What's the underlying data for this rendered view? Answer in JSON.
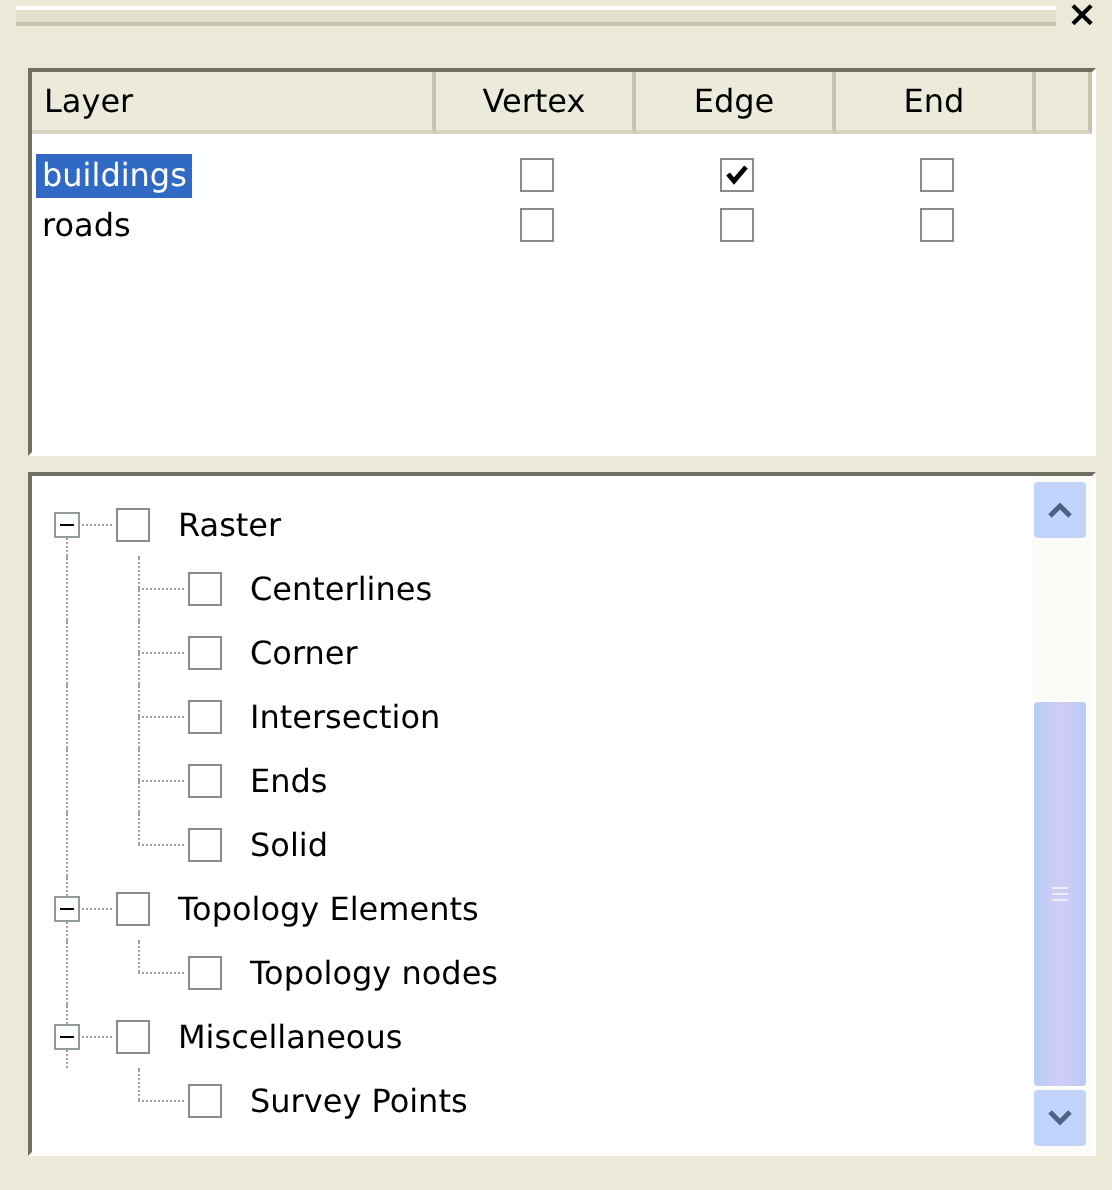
{
  "window": {
    "close": "×"
  },
  "layers_table": {
    "columns": [
      "Layer",
      "Vertex",
      "Edge",
      "End"
    ],
    "rows": [
      {
        "layer": "buildings",
        "selected": true,
        "vertex": false,
        "edge": true,
        "end": false
      },
      {
        "layer": "roads",
        "selected": false,
        "vertex": false,
        "edge": false,
        "end": false
      }
    ]
  },
  "snap_tree": [
    {
      "label": "Raster",
      "checked": false,
      "expanded": true,
      "children": [
        {
          "label": "Centerlines",
          "checked": false
        },
        {
          "label": "Corner",
          "checked": false
        },
        {
          "label": "Intersection",
          "checked": false
        },
        {
          "label": "Ends",
          "checked": false
        },
        {
          "label": "Solid",
          "checked": false
        }
      ]
    },
    {
      "label": "Topology Elements",
      "checked": false,
      "expanded": true,
      "children": [
        {
          "label": "Topology nodes",
          "checked": false
        }
      ]
    },
    {
      "label": "Miscellaneous",
      "checked": false,
      "expanded": true,
      "children": [
        {
          "label": "Survey Points",
          "checked": false
        }
      ]
    }
  ]
}
